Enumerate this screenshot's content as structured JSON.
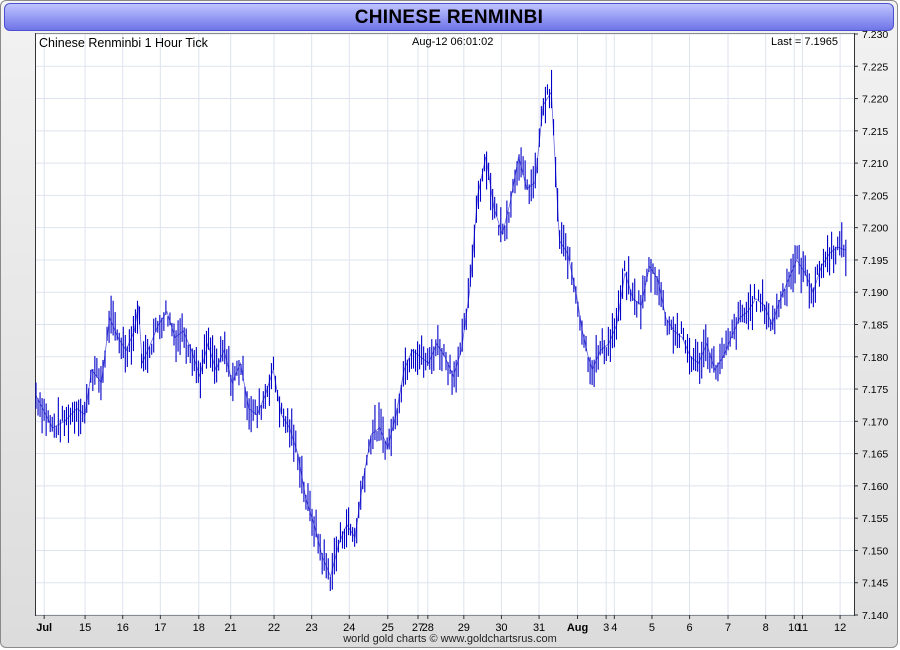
{
  "title": "CHINESE RENMINBI",
  "header": {
    "left": "Chinese Renminbi 1 Hour Tick",
    "middle": "Aug-12  06:01:02",
    "right": "Last = 7.1965"
  },
  "footer": "world gold charts © www.goldchartsrus.com",
  "colors": {
    "series": "#0000c8",
    "title_bar": "#8a8ff0",
    "grid": "#dde3ee"
  },
  "chart_data": {
    "type": "line",
    "title": "CHINESE RENMINBI",
    "subtitle": "Chinese Renminbi 1 Hour Tick",
    "ylim": [
      7.14,
      7.23
    ],
    "y_ticks": [
      7.14,
      7.145,
      7.15,
      7.155,
      7.16,
      7.165,
      7.17,
      7.175,
      7.18,
      7.185,
      7.19,
      7.195,
      7.2,
      7.205,
      7.21,
      7.215,
      7.22,
      7.225,
      7.23
    ],
    "y_tick_labels": [
      "7.140",
      "7.145",
      "7.150",
      "7.155",
      "7.160",
      "7.165",
      "7.170",
      "7.175",
      "7.180",
      "7.185",
      "7.190",
      "7.195",
      "7.200",
      "7.205",
      "7.210",
      "7.215",
      "7.220",
      "7.225",
      "7.230"
    ],
    "x_ticks": [
      {
        "label": "Jul",
        "pos": 0.01
      },
      {
        "label": "15",
        "pos": 0.06
      },
      {
        "label": "16",
        "pos": 0.106
      },
      {
        "label": "17",
        "pos": 0.152
      },
      {
        "label": "18",
        "pos": 0.199
      },
      {
        "label": "21",
        "pos": 0.238
      },
      {
        "label": "22",
        "pos": 0.291
      },
      {
        "label": "23",
        "pos": 0.337
      },
      {
        "label": "24",
        "pos": 0.383
      },
      {
        "label": "25",
        "pos": 0.43
      },
      {
        "label": "27",
        "pos": 0.467
      },
      {
        "label": "28",
        "pos": 0.479
      },
      {
        "label": "29",
        "pos": 0.523
      },
      {
        "label": "30",
        "pos": 0.569
      },
      {
        "label": "31",
        "pos": 0.615
      },
      {
        "label": "Aug",
        "pos": 0.662
      },
      {
        "label": "3",
        "pos": 0.697
      },
      {
        "label": "4",
        "pos": 0.707
      },
      {
        "label": "5",
        "pos": 0.753
      },
      {
        "label": "6",
        "pos": 0.799
      },
      {
        "label": "7",
        "pos": 0.846
      },
      {
        "label": "8",
        "pos": 0.892
      },
      {
        "label": "10",
        "pos": 0.927
      },
      {
        "label": "11",
        "pos": 0.937
      },
      {
        "label": "12",
        "pos": 0.983
      }
    ],
    "series": [
      {
        "color": "#0000c8",
        "x": [
          0,
          0.02,
          0.035,
          0.05,
          0.06,
          0.068,
          0.08,
          0.09,
          0.1,
          0.11,
          0.12,
          0.125,
          0.13,
          0.14,
          0.15,
          0.16,
          0.17,
          0.18,
          0.19,
          0.2,
          0.21,
          0.22,
          0.23,
          0.24,
          0.25,
          0.26,
          0.27,
          0.28,
          0.29,
          0.3,
          0.31,
          0.32,
          0.33,
          0.34,
          0.35,
          0.36,
          0.37,
          0.38,
          0.39,
          0.4,
          0.41,
          0.42,
          0.43,
          0.44,
          0.45,
          0.46,
          0.47,
          0.48,
          0.49,
          0.5,
          0.51,
          0.52,
          0.53,
          0.54,
          0.55,
          0.56,
          0.57,
          0.58,
          0.59,
          0.6,
          0.61,
          0.62,
          0.63,
          0.64,
          0.65,
          0.66,
          0.668,
          0.675,
          0.68,
          0.69,
          0.7,
          0.71,
          0.72,
          0.73,
          0.74,
          0.75,
          0.76,
          0.77,
          0.78,
          0.79,
          0.8,
          0.81,
          0.82,
          0.83,
          0.84,
          0.85,
          0.86,
          0.87,
          0.88,
          0.89,
          0.9,
          0.91,
          0.92,
          0.93,
          0.94,
          0.95,
          0.96,
          0.97,
          0.98,
          0.99
        ],
        "y": [
          7.174,
          7.169,
          7.17,
          7.172,
          7.171,
          7.178,
          7.176,
          7.186,
          7.183,
          7.181,
          7.184,
          7.188,
          7.179,
          7.182,
          7.185,
          7.187,
          7.183,
          7.184,
          7.181,
          7.177,
          7.182,
          7.178,
          7.181,
          7.176,
          7.179,
          7.172,
          7.171,
          7.174,
          7.178,
          7.171,
          7.169,
          7.165,
          7.158,
          7.154,
          7.149,
          7.146,
          7.151,
          7.154,
          7.152,
          7.161,
          7.168,
          7.169,
          7.166,
          7.171,
          7.178,
          7.181,
          7.18,
          7.179,
          7.182,
          7.18,
          7.177,
          7.181,
          7.19,
          7.205,
          7.211,
          7.203,
          7.199,
          7.204,
          7.211,
          7.206,
          7.207,
          7.219,
          7.221,
          7.198,
          7.196,
          7.19,
          7.184,
          7.18,
          7.178,
          7.181,
          7.182,
          7.185,
          7.193,
          7.189,
          7.188,
          7.194,
          7.192,
          7.186,
          7.184,
          7.183,
          7.18,
          7.179,
          7.182,
          7.178,
          7.18,
          7.183,
          7.186,
          7.187,
          7.189,
          7.188,
          7.185,
          7.189,
          7.192,
          7.195,
          7.193,
          7.19,
          7.194,
          7.196,
          7.197,
          7.1965
        ]
      }
    ],
    "grid": true
  }
}
